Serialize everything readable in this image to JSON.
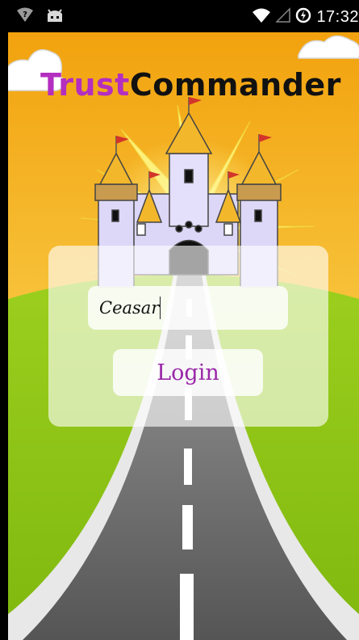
{
  "status_bar": {
    "time": "17:32",
    "icons_left": [
      "help-icon",
      "android-robot-icon"
    ],
    "icons_right": [
      "wifi-icon",
      "no-signal-icon",
      "data-saver-icon"
    ]
  },
  "app": {
    "title_part1": "Trust",
    "title_part2": "Commander"
  },
  "login_form": {
    "username_value": "Ceasar",
    "login_label": "Login"
  },
  "colors": {
    "title_purple": "#b42ec0",
    "login_text": "#9a27a8",
    "sky_top": "#f2a20e",
    "grass": "#8cc414",
    "road": "#6f6f6f"
  }
}
